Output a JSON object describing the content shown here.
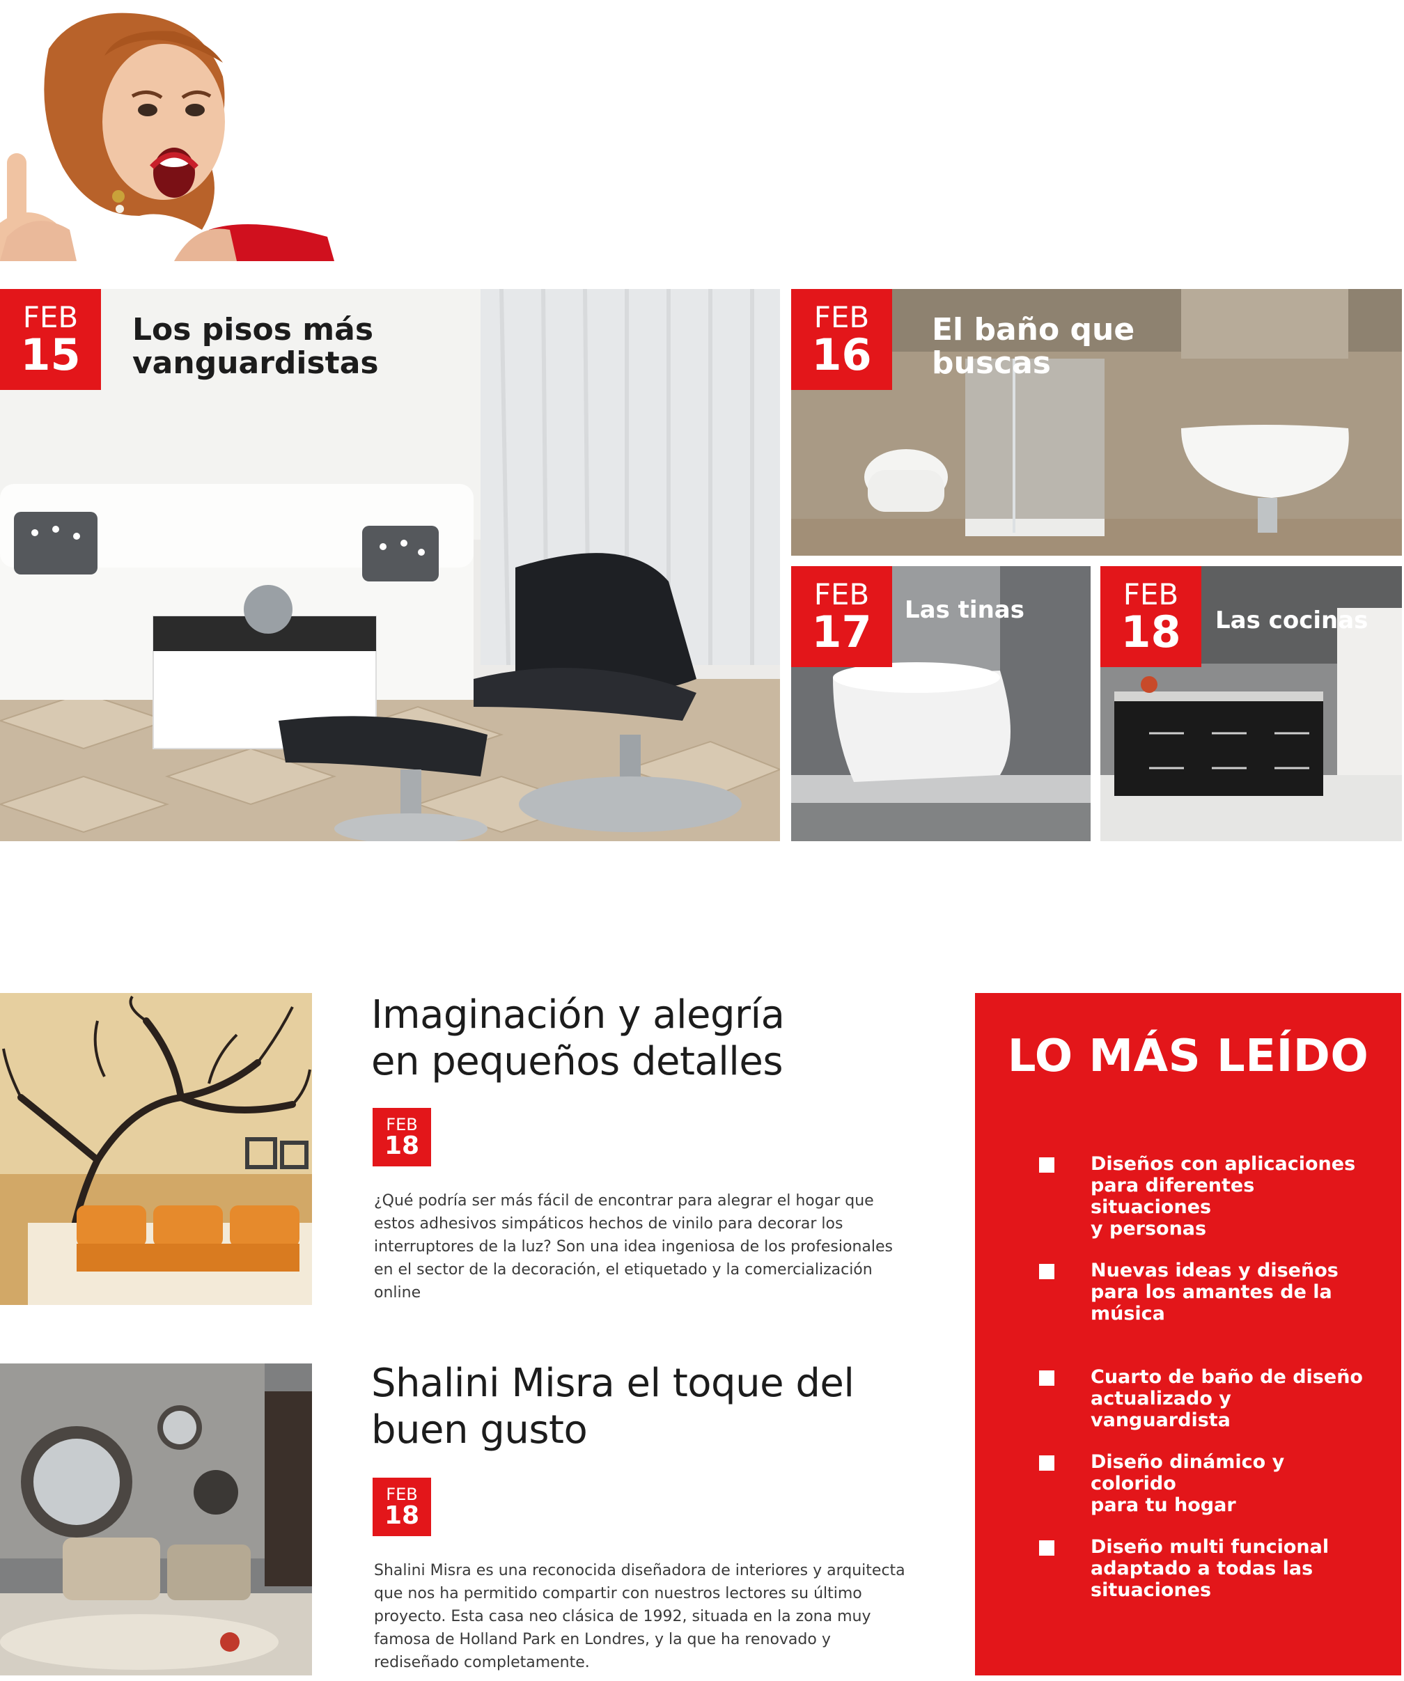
{
  "colors": {
    "accent": "#e3161a",
    "text": "#1c1c1c",
    "white": "#ffffff"
  },
  "featured": [
    {
      "month": "FEB",
      "day": "15",
      "title_line1": "Los pisos más",
      "title_line2": "vanguardistas"
    },
    {
      "month": "FEB",
      "day": "16",
      "title_line1": "El baño que",
      "title_line2": "buscas"
    },
    {
      "month": "FEB",
      "day": "17",
      "title": "Las tinas"
    },
    {
      "month": "FEB",
      "day": "18",
      "title": "Las cocinas"
    }
  ],
  "articles": [
    {
      "title_line1": "Imaginación y alegría",
      "title_line2": "en pequeños detalles",
      "month": "FEB",
      "day": "18",
      "body": [
        "¿Qué podría ser más fácil de encontrar para alegrar el hogar que",
        "estos adhesivos simpáticos hechos de vinilo para decorar los",
        "interruptores de la luz? Son una idea ingeniosa de los profesionales",
        "en el sector de la decoración, el etiquetado y la comercialización",
        "online"
      ]
    },
    {
      "title_line1": "Shalini Misra el toque del",
      "title_line2": "buen gusto",
      "month": "FEB",
      "day": "18",
      "body": [
        "Shalini Misra es una reconocida diseñadora de interiores y arquitecta",
        "que nos ha permitido compartir con nuestros lectores su último",
        "proyecto. Esta casa neo clásica de 1992, situada en la zona muy",
        "famosa de Holland Park en Londres, y la que ha renovado y",
        "rediseñado completamente."
      ]
    }
  ],
  "sidebar": {
    "title": "LO MÁS LEÍDO",
    "items": [
      [
        "Diseños con aplicaciones",
        "para diferentes situaciones",
        "y personas"
      ],
      [
        "Nuevas ideas y diseños",
        "para los amantes de la",
        "música"
      ],
      [
        "Cuarto de baño de diseño",
        "actualizado y vanguardista"
      ],
      [
        "Diseño dinámico y colorido",
        "para tu hogar"
      ],
      [
        "Diseño multi funcional",
        "adaptado a todas las",
        "situaciones"
      ]
    ]
  }
}
